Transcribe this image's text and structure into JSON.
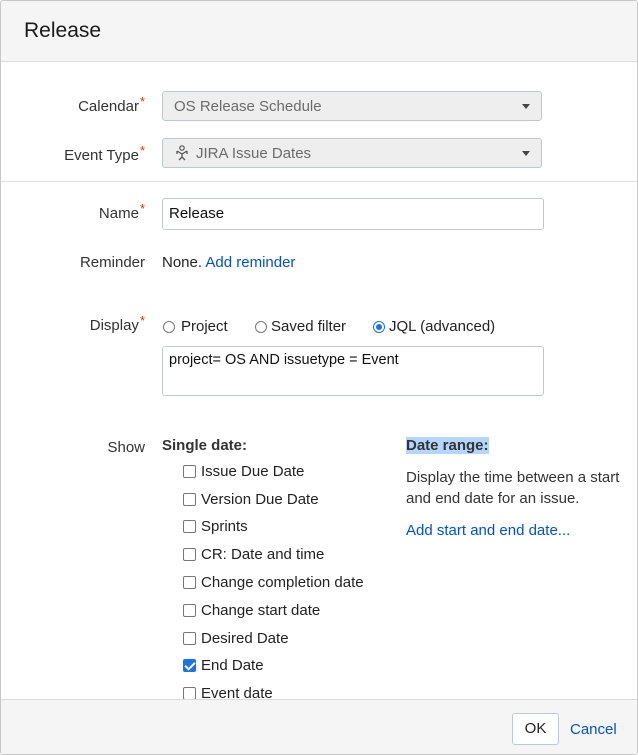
{
  "dialog": {
    "title": "Release"
  },
  "form": {
    "calendar": {
      "label": "Calendar",
      "value": "OS Release Schedule"
    },
    "event_type": {
      "label": "Event Type",
      "value": "JIRA Issue Dates",
      "icon": "jira-icon"
    },
    "name": {
      "label": "Name",
      "value": "Release"
    },
    "reminder": {
      "label": "Reminder",
      "value": "None.",
      "link": "Add reminder"
    },
    "display": {
      "label": "Display",
      "options": [
        {
          "label": "Project",
          "selected": false
        },
        {
          "label": "Saved filter",
          "selected": false
        },
        {
          "label": "JQL (advanced)",
          "selected": true
        }
      ],
      "query": "project= OS AND issuetype = Event"
    },
    "show": {
      "label": "Show",
      "single_date_heading": "Single date:",
      "single_dates": [
        {
          "label": "Issue Due Date",
          "checked": false
        },
        {
          "label": "Version Due Date",
          "checked": false
        },
        {
          "label": "Sprints",
          "checked": false
        },
        {
          "label": "CR: Date and time",
          "checked": false
        },
        {
          "label": "Change completion date",
          "checked": false
        },
        {
          "label": "Change start date",
          "checked": false
        },
        {
          "label": "Desired Date",
          "checked": false
        },
        {
          "label": "End Date",
          "checked": true
        },
        {
          "label": "Event date",
          "checked": false
        }
      ],
      "date_range_heading": "Date range:",
      "date_range_description": "Display the time between a start and end date for an issue.",
      "date_range_link": "Add start and end date..."
    },
    "required_mark": "*"
  },
  "footer": {
    "ok_label": "OK",
    "cancel_label": "Cancel"
  },
  "colors": {
    "link": "#0052cc",
    "required": "#de350b",
    "radio_selected": "#1a73e8",
    "highlight": "#b4d5fe"
  }
}
